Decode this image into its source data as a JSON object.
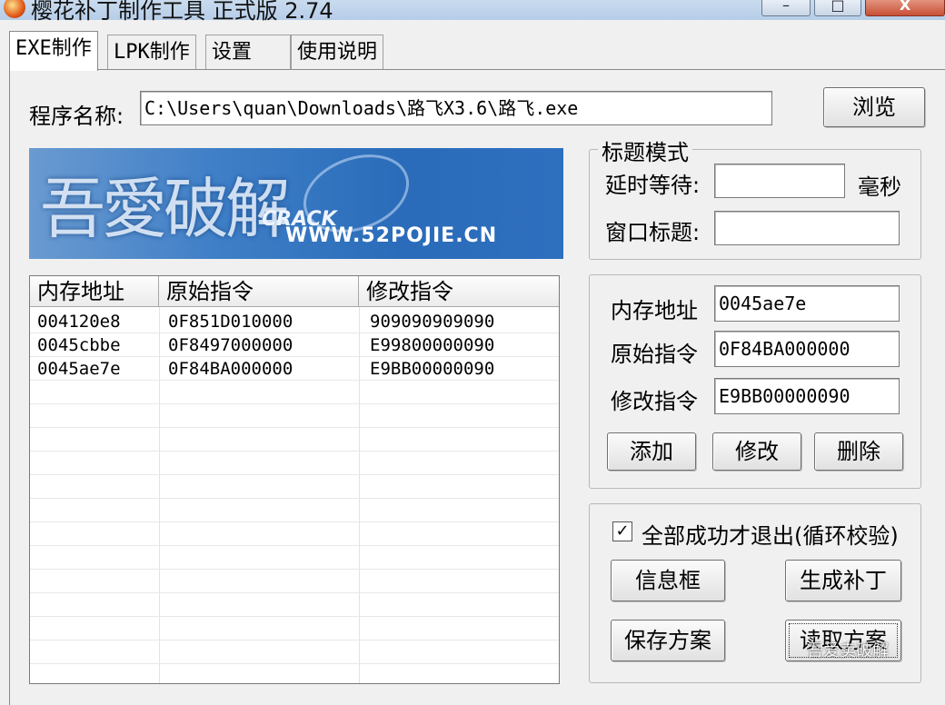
{
  "window": {
    "title": "樱花补丁制作工具 正式版 2.74",
    "min_glyph": "–",
    "max_glyph": "□",
    "close_glyph": "X"
  },
  "tabs": [
    "EXE制作",
    "LPK制作",
    "设置",
    "使用说明"
  ],
  "program": {
    "label": "程序名称:",
    "path": "C:\\Users\\quan\\Downloads\\路飞X3.6\\路飞.exe",
    "browse": "浏览"
  },
  "banner": {
    "chars": "吾愛破解",
    "crack": "CRACK",
    "url": "WWW.52POJIE.CN"
  },
  "title_mode": {
    "legend": "标题模式",
    "delay_label": "延时等待:",
    "delay_value": "",
    "unit": "毫秒",
    "window_title_label": "窗口标题:",
    "window_title_value": ""
  },
  "patch_list": {
    "columns": [
      "内存地址",
      "原始指令",
      "修改指令"
    ],
    "rows": [
      [
        "004120e8",
        "0F851D010000",
        "909090909090"
      ],
      [
        "0045cbbe",
        "0F8497000000",
        "E99800000090"
      ],
      [
        "0045ae7e",
        "0F84BA000000",
        "E9BB00000090"
      ]
    ]
  },
  "editor": {
    "address_label": "内存地址",
    "address_value": "0045ae7e",
    "orig_label": "原始指令",
    "orig_value": "0F84BA000000",
    "mod_label": "修改指令",
    "mod_value": "E9BB00000090",
    "add": "添加",
    "modify": "修改",
    "delete": "删除"
  },
  "options": {
    "checkbox_label": "全部成功才退出(循环校验)",
    "checked": true,
    "check_glyph": "✓",
    "info_box": "信息框",
    "generate": "生成补丁",
    "save_scheme": "保存方案",
    "load_scheme": "读取方案"
  },
  "watermark": "吾爱卖破解"
}
